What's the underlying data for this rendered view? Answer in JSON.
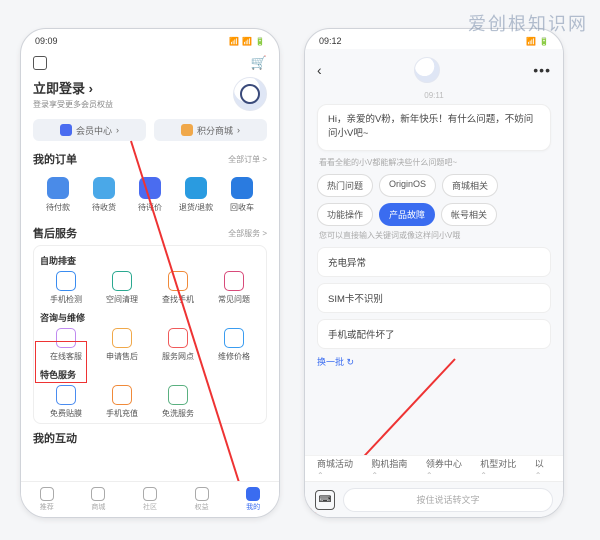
{
  "watermark": "爱创根知识网",
  "left": {
    "status_time": "09:09",
    "login_title": "立即登录",
    "login_sub": "登录享受更多会员权益",
    "pills": {
      "member": "会员中心",
      "points": "积分商城"
    },
    "orders": {
      "title": "我的订单",
      "more": "全部订单 >",
      "items": [
        "待付款",
        "待收货",
        "待评价",
        "退货/退款",
        "回收车"
      ]
    },
    "aftersales": {
      "title": "售后服务",
      "more": "全部服务 >",
      "self_title": "自助排查",
      "self_items": [
        "手机检测",
        "空间清理",
        "查找手机",
        "常见问题"
      ],
      "consult_title": "咨询与维修",
      "consult_items": [
        "在线客服",
        "申请售后",
        "服务网点",
        "维修价格"
      ],
      "special_title": "特色服务",
      "special_items": [
        "免费贴膜",
        "手机充值",
        "免洗服务"
      ]
    },
    "interact_title": "我的互动",
    "bottom_nav": [
      "推荐",
      "商城",
      "社区",
      "权益",
      "我的"
    ],
    "icon_colors": {
      "orders": [
        "#4a8be8",
        "#4aa8e8",
        "#4a6cf0",
        "#2a9be0",
        "#2a7be0"
      ],
      "self": [
        "#3a8cf0",
        "#2aa890",
        "#f08a3a",
        "#d84a7a"
      ],
      "consult": [
        "#c08af0",
        "#f0a84a",
        "#f05a5a",
        "#3a9cf0"
      ],
      "special": [
        "#4a8cf0",
        "#f08a3a",
        "#5ab080"
      ]
    }
  },
  "right": {
    "status_time": "09:12",
    "chat_time": "09:11",
    "bubble": "Hi，亲爱的V粉，新年快乐！有什么问题，不妨问问小V吧~",
    "hint1": "看看全能的小V都能解决些什么问题吧~",
    "chips": [
      "热门问题",
      "OriginOS",
      "商城相关",
      "功能操作",
      "产品故障",
      "帐号相关"
    ],
    "active_chip_index": 4,
    "hint2": "您可以直接输入关键词或像这样问小V哦",
    "questions": [
      "充电异常",
      "SIM卡不识别",
      "手机或配件坏了"
    ],
    "refresh": "换一批 ↻",
    "quick_links": [
      "商城活动",
      "购机指南",
      "领券中心",
      "机型对比",
      "以"
    ],
    "input_placeholder": "按住说话转文字"
  }
}
